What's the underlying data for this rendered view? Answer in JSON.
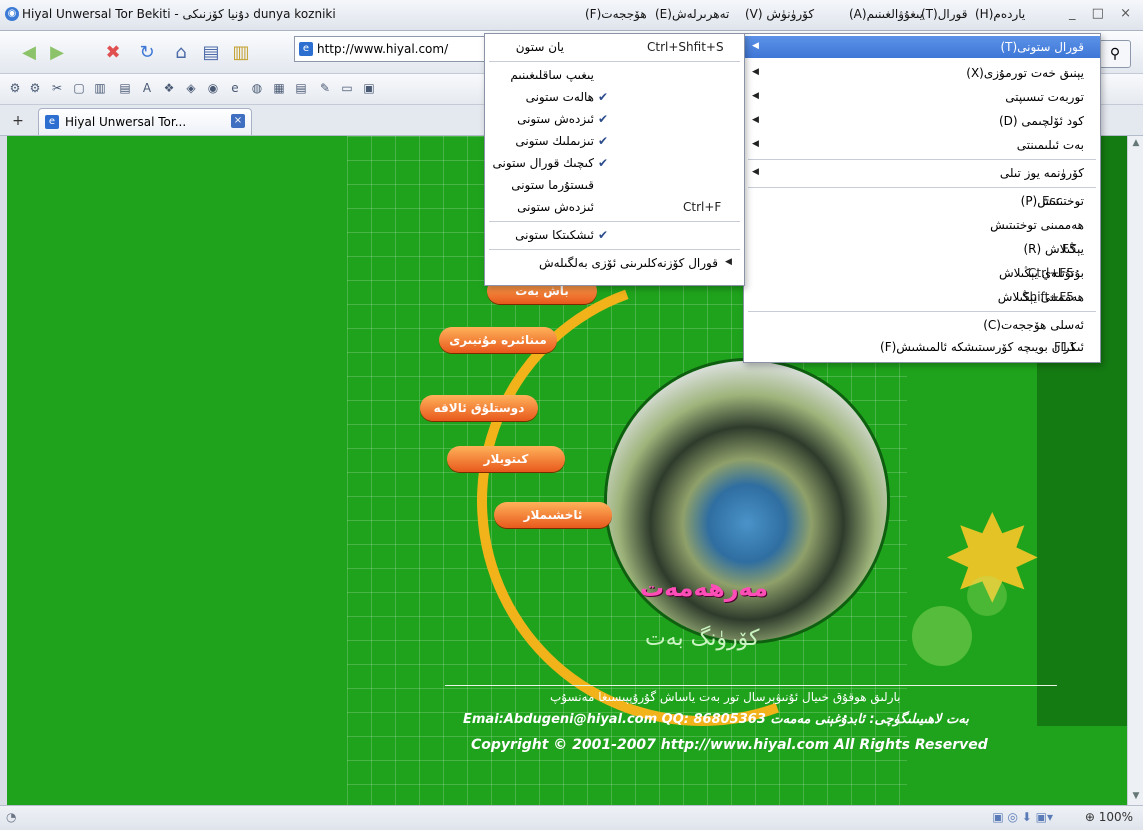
{
  "window": {
    "title": "Hiyal Unwersal Tor Bekiti - دۇنيا كۆزنىكى dunya kozniki",
    "controls": "_ □ ×"
  },
  "menubar": [
    {
      "label": "(H)ياردەم"
    },
    {
      "label": "(T)قورال"
    },
    {
      "label": "(A)يىغۇۋالغىنىم"
    },
    {
      "label": "(V) كۆرۈنۈش"
    },
    {
      "label": "(E)تەھرىرلەش"
    },
    {
      "label": "(F)ھۆججەت"
    }
  ],
  "toolbar": {
    "address": "http://www.hiyal.com/",
    "search_icon": "search-icon"
  },
  "tab": {
    "title": "Hiyal Unwersal Tor...",
    "close": "×",
    "new_tab": "+"
  },
  "page": {
    "nav_pills": [
      "باش بەت",
      "مىنائىرە مۇنبىرى",
      "دوستلۇق ئالاقە",
      "كىتوبلار",
      "ئاخشىملار"
    ],
    "brand_main": "مەرھەمەت",
    "brand_sub": "كۆرۈنگ بەت",
    "footer_line1": "بارلىق ھوقۇق خىيال ئۇنىۋېرسال تور بەت ياساش گۇرۇپپىسىغا مەنسۇپ",
    "footer_line2": "Emai:Abdugeni@hiyal.com   QQ: 86805363  بەت لاھىيىلىگۈچى: ئابدۇغېنى مەمەت",
    "footer_line3": "Copyright © 2001-2007  http://www.hiyal.com All Rights Reserved"
  },
  "status": {
    "zoom": "100%"
  },
  "view_menu": {
    "items": [
      {
        "label": "(T)قورال ستونى",
        "shortcut": "",
        "arrow": "◀",
        "highlight": true
      },
      {
        "label": "(X)يېنىق خەت تورمۇزى",
        "arrow": "◀"
      },
      {
        "label": "توربەت تىسىپتى",
        "arrow": "◀"
      },
      {
        "label": "(D) كود ئۆلچىمى",
        "arrow": "◀"
      },
      {
        "label": "بەت ئىلىمىنتى",
        "arrow": "◀"
      },
      {
        "label": "كۆرۈنمە يوز تىلى",
        "arrow": "◀"
      },
      {
        "label": "(P)توختىتىش",
        "shortcut": "Esc"
      },
      {
        "label": "ھەممىنى توختىتىش",
        "shortcut": ""
      },
      {
        "label": "(R) يېڭىلاش",
        "shortcut": "F5"
      },
      {
        "label": "بۇتۇنلەي يېڭىلاش",
        "shortcut": "Ctrl+F5"
      },
      {
        "label": "ھەممىنى يېڭىلاش",
        "shortcut": "Shift+F5"
      },
      {
        "label": "(C)ئەسلى ھۆججەت",
        "shortcut": ""
      },
      {
        "label": "(F)ئىكران بويىچە كۆرسىتىشكە ئالمىشىش",
        "shortcut": "F11"
      }
    ]
  },
  "toolbar_submenu": {
    "items": [
      {
        "label": "يان ستون",
        "shortcut": "Ctrl+Shfit+S",
        "checked": false
      },
      {
        "label": "يىغىپ ساقلىغىنىم",
        "checked": false
      },
      {
        "label": "ھالەت ستونى",
        "checked": true
      },
      {
        "label": "ئىزدەش ستونى",
        "checked": true
      },
      {
        "label": "تىزىملىك ستونى",
        "checked": true
      },
      {
        "label": "كىچىك قورال ستونى",
        "checked": true
      },
      {
        "label": "قىستۇرما ستونى",
        "checked": false
      },
      {
        "label": "ئىزدەش ستونى",
        "shortcut": "Ctrl+F",
        "checked": false
      },
      {
        "label": "ئىشكىتكا ستونى",
        "checked": true
      },
      {
        "label": "قورال كۆزنەكلىرىنى ئۆزى بەلگىلەش",
        "arrow": "◀",
        "checked": false
      }
    ],
    "check_glyph": "✔"
  }
}
